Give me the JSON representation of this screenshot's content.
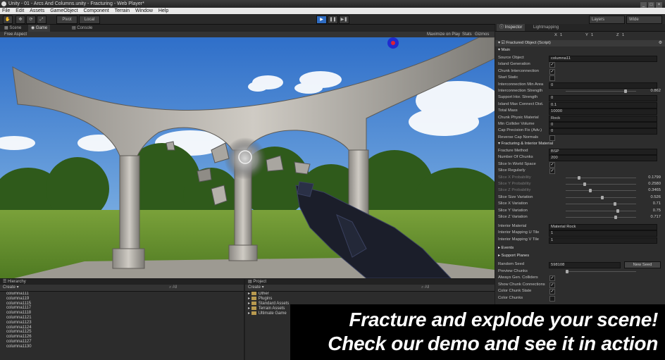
{
  "window": {
    "title": "Unity - 01 - Arcs And Columns.unity - Fracturing - Web Player*",
    "controls": [
      "_",
      "□",
      "×"
    ]
  },
  "menu": [
    "File",
    "Edit",
    "Assets",
    "GameObject",
    "Component",
    "Terrain",
    "Window",
    "Help"
  ],
  "toolbar": {
    "pivot": "Pivot",
    "local": "Local",
    "play": "▶",
    "pause": "❚❚",
    "step": "▶❚",
    "layers": "Layers",
    "layout": "Wide"
  },
  "view_tabs": {
    "scene": "Scene",
    "game": "Game",
    "console": "Console",
    "aspect": "Free Aspect",
    "maximize": "Maximize on Play",
    "stats": "Stats",
    "gizmos": "Gizmos"
  },
  "inspector": {
    "tab_inspector": "Inspector",
    "tab_lightmapping": "Lightmapping",
    "xyz": [
      "X",
      "Y",
      "Z"
    ],
    "xyz_values": [
      "1",
      "1",
      "1"
    ],
    "component_title": "Fractured Object (Script)",
    "section_main": "Main",
    "rows_main": [
      {
        "label": "Source Object",
        "value": "columna11",
        "kind": "box"
      },
      {
        "label": "Island Generation",
        "checked": true,
        "kind": "check"
      },
      {
        "label": "Chunk Interconnection",
        "checked": true,
        "kind": "check"
      },
      {
        "label": "Start Static",
        "checked": false,
        "kind": "check"
      },
      {
        "label": "Interconnection Min Area",
        "value": "0",
        "kind": "box"
      },
      {
        "label": "Interconnection Strength",
        "value": "0.862",
        "fraction": 0.862,
        "kind": "slider"
      },
      {
        "label": "Support Hor. Strength",
        "value": "0",
        "kind": "box"
      },
      {
        "label": "Island Max Connect Dist.",
        "value": "0.1",
        "kind": "box"
      },
      {
        "label": "Total Mass",
        "value": "10000",
        "kind": "box"
      },
      {
        "label": "Chunk Physic Material",
        "value": "Rock",
        "kind": "box"
      },
      {
        "label": "Min Collider Volume",
        "value": "0",
        "kind": "box"
      },
      {
        "label": "Cap Precision Fix (Adv.)",
        "value": "0",
        "kind": "box"
      },
      {
        "label": "Reverse Cap Normals",
        "checked": false,
        "kind": "check"
      }
    ],
    "section_fracturing": "Fracturing & Interior Material",
    "rows_fracturing": [
      {
        "label": "Fracture Method",
        "value": "BSP",
        "kind": "box"
      },
      {
        "label": "Number Of Chunks",
        "value": "200",
        "kind": "box"
      },
      {
        "label": "Slice In World Space",
        "checked": true,
        "kind": "check"
      },
      {
        "label": "Slice Regularly",
        "checked": true,
        "kind": "check"
      },
      {
        "label": "Slice X Probability",
        "value": "0.1799",
        "fraction": 0.1799,
        "kind": "slider",
        "dim": true
      },
      {
        "label": "Slice Y Probability",
        "value": "0.2580",
        "fraction": 0.258,
        "kind": "slider",
        "dim": true
      },
      {
        "label": "Slice Z Probability",
        "value": "0.3465",
        "fraction": 0.3465,
        "kind": "slider",
        "dim": true
      },
      {
        "label": "Slice Size Variation",
        "value": "0.526",
        "fraction": 0.526,
        "kind": "slider"
      },
      {
        "label": "Slice X Variation",
        "value": "0.71",
        "fraction": 0.71,
        "kind": "slider"
      },
      {
        "label": "Slice Y Variation",
        "value": "0.75",
        "fraction": 0.75,
        "kind": "slider"
      },
      {
        "label": "Slice Z Variation",
        "value": "0.717",
        "fraction": 0.717,
        "kind": "slider"
      }
    ],
    "rows_interior": [
      {
        "label": "Interior Material",
        "value": "Material Rock",
        "kind": "box"
      },
      {
        "label": "Interior Mapping U Tile",
        "value": "1",
        "kind": "box"
      },
      {
        "label": "Interior Mapping V Tile",
        "value": "1",
        "kind": "box"
      }
    ],
    "section_events": "Events",
    "section_support": "Support Planes",
    "random_seed_label": "Random Seed",
    "random_seed_value": "598108",
    "new_seed": "New Seed",
    "rows_bottom": [
      {
        "label": "Preview Chunks",
        "kind": "slider-only",
        "fraction": 0.0
      },
      {
        "label": "Always Gen. Colliders",
        "checked": true,
        "kind": "check"
      },
      {
        "label": "Show Chunk Connections",
        "checked": true,
        "kind": "check"
      },
      {
        "label": "Color Chunk State",
        "checked": true,
        "kind": "check"
      },
      {
        "label": "Color Chunks",
        "checked": false,
        "kind": "check"
      }
    ]
  },
  "hierarchy": {
    "title": "Hierarchy",
    "create": "Create ▾",
    "search": "All",
    "items": [
      "columna111",
      "columna119",
      "columna1115",
      "columna1117",
      "columna1118",
      "columna1121",
      "columna1123",
      "columna1124",
      "columna1125",
      "columna1126",
      "columna1127",
      "columna1130"
    ]
  },
  "project": {
    "title": "Project",
    "create": "Create ▾",
    "search": "All",
    "items": [
      "Other",
      "Plugins",
      "Standard Assets",
      "Terrain Assets",
      "Ultimate Game"
    ]
  },
  "banner": {
    "line1": "Fracture and explode your scene!",
    "line2": "Check our demo and see it in action"
  },
  "colors": {
    "accent": "#2f6cc2",
    "sky": "#4f8fd8",
    "grass": "#5f8a2a",
    "stone": "#b6b3ad"
  }
}
